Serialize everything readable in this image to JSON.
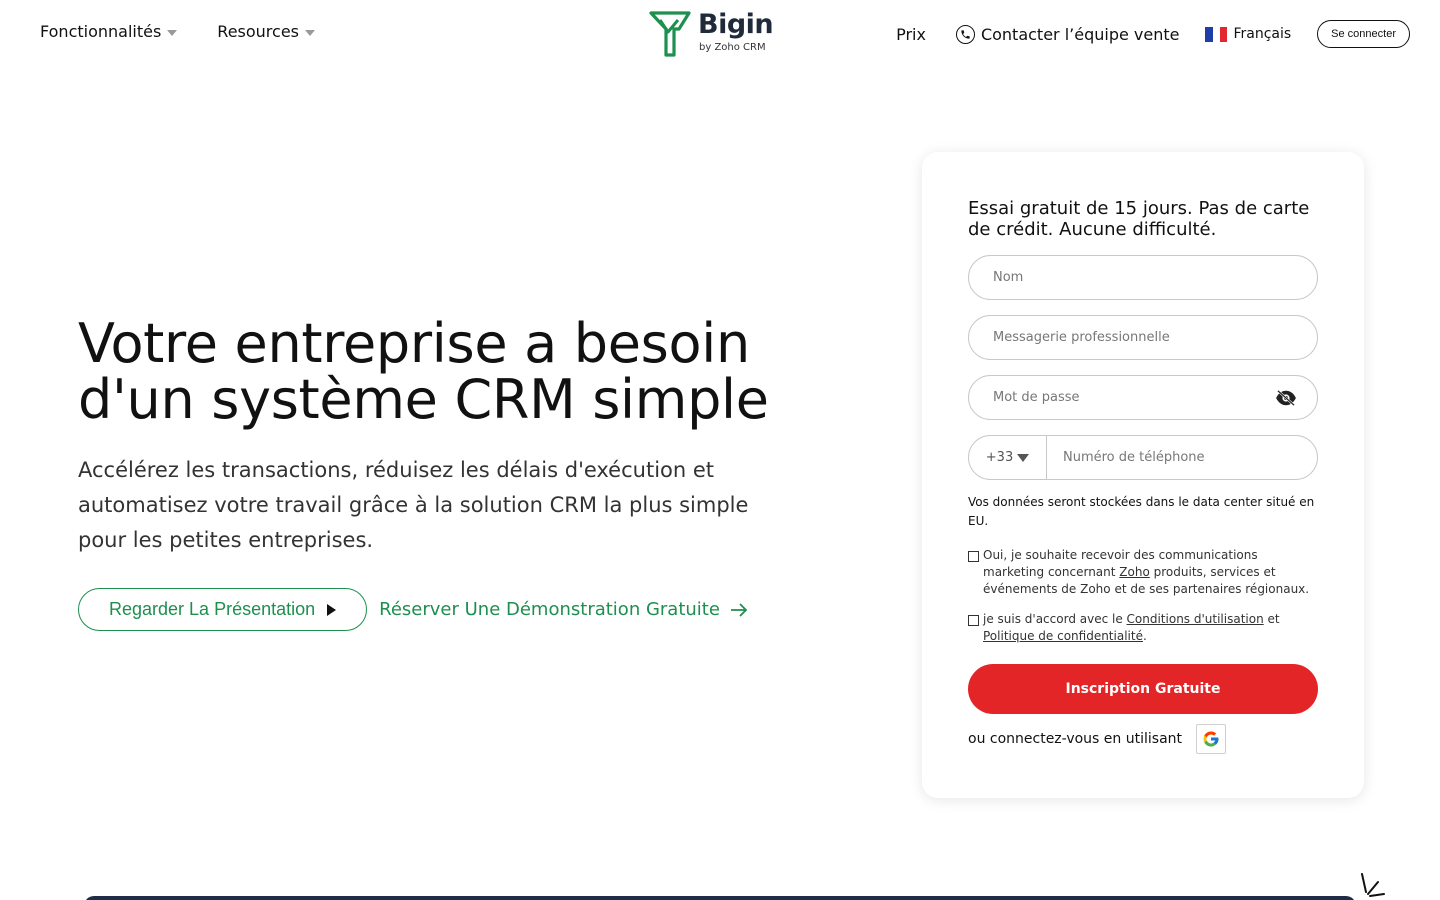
{
  "nav": {
    "features": "Fonctionnalités",
    "resources": "Resources",
    "pricing": "Prix",
    "contact_sales": "Contacter l’équipe vente",
    "language": "Français",
    "login": "Se connecter"
  },
  "logo": {
    "word": "Bigin",
    "sub": "by Zoho CRM"
  },
  "hero": {
    "title": "Votre entreprise a besoin d'un système CRM simple",
    "subtitle": "Accélérez les transactions, réduisez les délais d'exécution et automatisez votre travail grâce à la solution CRM la plus simple pour les petites entreprises.",
    "watch_video": "Regarder La Présentation",
    "book_demo": "Réserver Une Démonstration Gratuite"
  },
  "signup": {
    "title": "Essai gratuit de 15 jours. Pas de carte de crédit. Aucune difficulté.",
    "name_placeholder": "Nom",
    "email_placeholder": "Messagerie professionnelle",
    "password_placeholder": "Mot de passe",
    "country_code": "+33",
    "phone_placeholder": "Numéro de téléphone",
    "data_note": "Vos données seront stockées dans le data center situé en EU.",
    "marketing_pre": "Oui, je souhaite recevoir des communications marketing concernant ",
    "marketing_link": "Zoho",
    "marketing_post": " produits, services et événements de Zoho et de ses partenaires régionaux.",
    "terms_pre": "je suis d'accord avec le ",
    "terms_link": "Conditions d'utilisation",
    "terms_mid": " et ",
    "privacy_link": "Politique de confidentialité",
    "terms_end": ".",
    "submit": "Inscription Gratuite",
    "social_text": "ou connectez-vous en utilisant"
  },
  "colors": {
    "brand_green": "#1d8f4e",
    "signup_red": "#e42527",
    "dark_band": "#1f2d46"
  },
  "icons": {
    "features_caret": "chevron-down-icon",
    "phone": "phone-icon",
    "flag": "flag-fr-icon",
    "play": "play-icon",
    "arrow": "arrow-right-icon",
    "eye": "eye-slash-icon",
    "google": "google-icon"
  }
}
